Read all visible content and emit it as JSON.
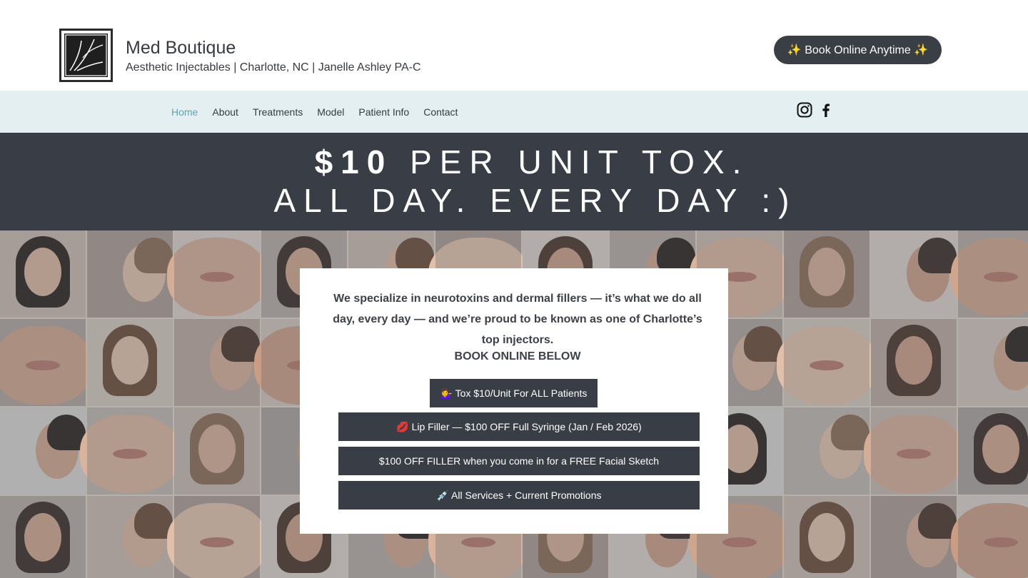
{
  "header": {
    "brand_name": "Med Boutique",
    "brand_subtitle": "Aesthetic Injectables | Charlotte, NC | Janelle Ashley PA-C",
    "book_button": "✨ Book Online Anytime ✨"
  },
  "nav": {
    "items": [
      "Home",
      "About",
      "Treatments",
      "Model",
      "Patient Info",
      "Contact"
    ],
    "active": "Home",
    "social_icons": [
      "instagram-icon",
      "facebook-icon"
    ]
  },
  "banner": {
    "line1_bold": "$10",
    "line1_rest": "PER UNIT TOX.",
    "line2": "ALL DAY. EVERY DAY :)"
  },
  "card": {
    "intro": "We specialize in neurotoxins and dermal fillers — it’s what we do all day, every day — and we’re proud to be known as one of Charlotte’s top injectors.",
    "book_heading": "BOOK ONLINE BELOW",
    "buttons": [
      "💁‍♀️ Tox $10/Unit For ALL Patients",
      "💋 Lip Filler — $100 OFF Full Syringe (Jan / Feb 2026)",
      "$100 OFF FILLER when you come in for a FREE Facial Sketch",
      "💉 All Services + Current Promotions"
    ]
  },
  "colors": {
    "dark": "#393e46",
    "nav_bg": "#e3eff0",
    "nav_active": "#5aa7ad",
    "text": "#363b42"
  }
}
